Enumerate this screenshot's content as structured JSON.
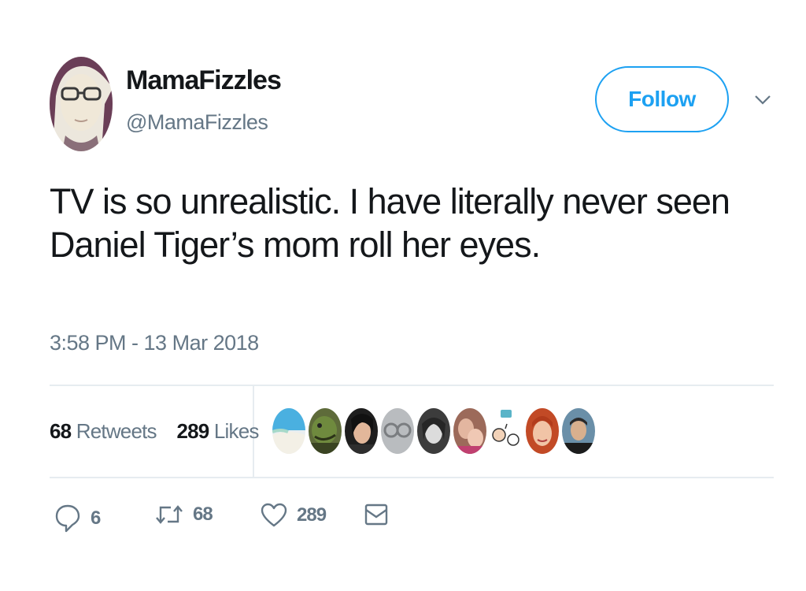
{
  "author": {
    "name": "MamaFizzles",
    "handle": "@MamaFizzles"
  },
  "follow_label": "Follow",
  "tweet": {
    "lines": [
      "TV is so unrealistic. I have literally never seen",
      "Daniel Tiger’s mom roll her eyes."
    ],
    "timestamp": "3:58 PM - 13 Mar 2018"
  },
  "stats": {
    "retweets_count": "68",
    "retweets_label": "Retweets",
    "likes_count": "289",
    "likes_label": "Likes"
  },
  "liker_avatars": 9,
  "actions": {
    "reply_count": "6",
    "retweet_count": "68",
    "like_count": "289"
  },
  "colors": {
    "accent": "#1da1f2",
    "secondary_text": "#657786",
    "divider": "#e6ecf0"
  },
  "icons": [
    "reply-icon",
    "retweet-icon",
    "heart-icon",
    "envelope-icon",
    "chevron-down-icon"
  ]
}
